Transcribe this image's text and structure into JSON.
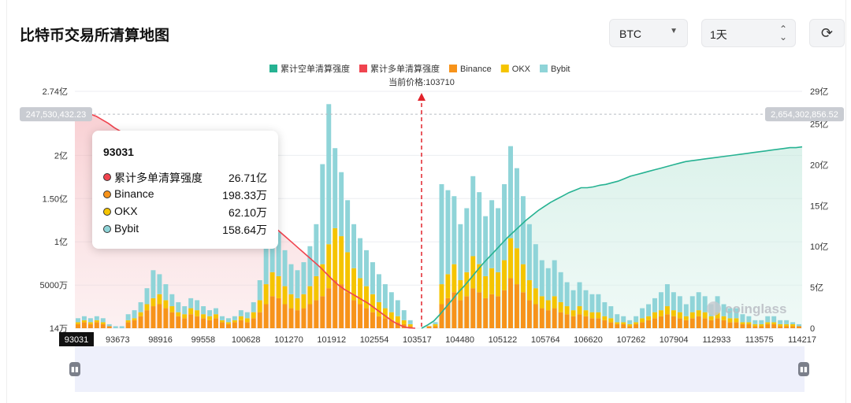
{
  "header": {
    "title": "比特币交易所清算地图",
    "asset_select": "BTC",
    "range_select": "1天",
    "refresh_icon": "refresh-icon"
  },
  "tooltip": {
    "title": "93031",
    "rows": [
      {
        "label": "累计多单清算强度",
        "value": "26.71亿",
        "color": "#f0444f"
      },
      {
        "label": "Binance",
        "value": "198.33万",
        "color": "#f7931a"
      },
      {
        "label": "OKX",
        "value": "62.10万",
        "color": "#f5c400"
      },
      {
        "label": "Bybit",
        "value": "158.64万",
        "color": "#8fd4d8"
      }
    ]
  },
  "watermark": "coinglass",
  "chart_data": {
    "type": "bar",
    "legend": [
      {
        "name": "累计空单清算强度",
        "color": "#26b292"
      },
      {
        "name": "累计多单清算强度",
        "color": "#f0444f"
      },
      {
        "name": "Binance",
        "color": "#f7931a"
      },
      {
        "name": "OKX",
        "color": "#f5c400"
      },
      {
        "name": "Bybit",
        "color": "#8fd4d8"
      }
    ],
    "legend_position": "top-center",
    "current_price_label": "当前价格:103710",
    "current_price": 103710,
    "left_axis_ticks": [
      "14万",
      "5000万",
      "1亿",
      "1.50亿",
      "2亿",
      "2.74亿"
    ],
    "left_axis_values": [
      140000,
      50000000,
      100000000,
      150000000,
      200000000,
      274000000
    ],
    "left_ylim": [
      140000,
      274000000
    ],
    "right_axis_ticks": [
      "0",
      "5亿",
      "10亿",
      "15亿",
      "20亿",
      "25亿",
      "29亿"
    ],
    "right_axis_values": [
      0,
      500000000,
      1000000000,
      1500000000,
      2000000000,
      2500000000,
      2900000000
    ],
    "right_ylim": [
      0,
      2900000000
    ],
    "left_marker_label": "247,530,432.23",
    "left_marker_value": 247530432.23,
    "right_marker_label": "2,654,302,856.52",
    "right_marker_value": 2654302856.52,
    "x_ticks": [
      "93031",
      "93673",
      "98916",
      "99558",
      "100628",
      "101270",
      "101912",
      "102554",
      "103517",
      "104480",
      "105122",
      "105764",
      "106620",
      "107262",
      "107904",
      "112933",
      "113575",
      "114217"
    ],
    "x_range": [
      93031,
      114217
    ],
    "selected_x": "93031",
    "grid": true,
    "bars": {
      "Binance": [
        2,
        3,
        2,
        3,
        2,
        1,
        0,
        0,
        3,
        4,
        6,
        9,
        11,
        12,
        10,
        8,
        6,
        5,
        7,
        6,
        5,
        4,
        5,
        3,
        2,
        3,
        4,
        3,
        5,
        8,
        12,
        16,
        15,
        12,
        10,
        9,
        10,
        12,
        14,
        16,
        20,
        24,
        22,
        18,
        14,
        12,
        10,
        8,
        6,
        5,
        4,
        3,
        2,
        1,
        0,
        0,
        1,
        1,
        12,
        15,
        18,
        14,
        16,
        20,
        18,
        15,
        17,
        16,
        19,
        25,
        22,
        18,
        14,
        12,
        10,
        9,
        10,
        8,
        7,
        6,
        7,
        6,
        5,
        5,
        4,
        3,
        2,
        2,
        1,
        2,
        3,
        4,
        5,
        6,
        7,
        6,
        5,
        4,
        5,
        6,
        5,
        4,
        5,
        4,
        3,
        3,
        2,
        2,
        1,
        1,
        2,
        2,
        1,
        1,
        1,
        1
      ],
      "OKX": [
        1,
        1,
        1,
        1,
        1,
        0,
        0,
        0,
        1,
        1,
        2,
        3,
        4,
        5,
        4,
        3,
        2,
        2,
        3,
        3,
        2,
        2,
        2,
        1,
        1,
        1,
        2,
        2,
        3,
        6,
        10,
        12,
        11,
        9,
        7,
        6,
        7,
        9,
        12,
        16,
        22,
        26,
        24,
        20,
        16,
        13,
        11,
        9,
        7,
        5,
        4,
        3,
        2,
        1,
        0,
        0,
        0,
        1,
        10,
        12,
        14,
        10,
        12,
        16,
        14,
        11,
        13,
        12,
        15,
        20,
        18,
        14,
        10,
        8,
        6,
        5,
        6,
        5,
        4,
        3,
        4,
        3,
        3,
        3,
        2,
        2,
        1,
        1,
        1,
        1,
        2,
        2,
        3,
        3,
        4,
        3,
        3,
        2,
        3,
        3,
        3,
        2,
        3,
        2,
        2,
        2,
        1,
        1,
        1,
        1,
        1,
        1,
        1,
        1,
        1,
        0
      ],
      "Bybit": [
        2,
        2,
        2,
        2,
        2,
        1,
        1,
        1,
        3,
        4,
        5,
        8,
        14,
        10,
        8,
        6,
        5,
        4,
        5,
        5,
        4,
        3,
        3,
        2,
        2,
        2,
        3,
        3,
        5,
        10,
        18,
        24,
        22,
        18,
        15,
        14,
        16,
        20,
        26,
        50,
        70,
        40,
        32,
        26,
        22,
        20,
        18,
        16,
        14,
        12,
        10,
        8,
        5,
        2,
        0,
        0,
        0,
        1,
        50,
        42,
        34,
        28,
        32,
        40,
        36,
        30,
        34,
        32,
        38,
        46,
        40,
        34,
        28,
        22,
        18,
        16,
        18,
        15,
        12,
        10,
        12,
        10,
        9,
        9,
        7,
        6,
        4,
        3,
        2,
        3,
        5,
        6,
        7,
        9,
        11,
        9,
        8,
        6,
        8,
        9,
        8,
        6,
        8,
        6,
        5,
        5,
        4,
        3,
        2,
        2,
        3,
        3,
        2,
        2,
        1,
        1
      ]
    },
    "long_cumulative": [
      247530432,
      245000000,
      241000000,
      237000000,
      232000000,
      228000000,
      224000000,
      219000000,
      215000000,
      210000000,
      204000000,
      198000000,
      193000000,
      188000000,
      184000000,
      180000000,
      176000000,
      172000000,
      167000000,
      162000000,
      158000000,
      155000000,
      152000000,
      149000000,
      146000000,
      143000000,
      140000000,
      137000000,
      133000000,
      129000000,
      124000000,
      118000000,
      112000000,
      106000000,
      100000000,
      94000000,
      88000000,
      82000000,
      76000000,
      70000000,
      63000000,
      56000000,
      50000000,
      45000000,
      41000000,
      37000000,
      33000000,
      29000000,
      24000000,
      19000000,
      14000000,
      9000000,
      5000000,
      2000000,
      500000,
      140000
    ],
    "short_cumulative": [
      0,
      40000000,
      90000000,
      170000000,
      260000000,
      350000000,
      440000000,
      520000000,
      610000000,
      700000000,
      790000000,
      870000000,
      950000000,
      1030000000,
      1110000000,
      1180000000,
      1250000000,
      1320000000,
      1380000000,
      1440000000,
      1490000000,
      1540000000,
      1580000000,
      1620000000,
      1660000000,
      1690000000,
      1720000000,
      1720000000,
      1730000000,
      1750000000,
      1760000000,
      1780000000,
      1800000000,
      1830000000,
      1860000000,
      1880000000,
      1900000000,
      1920000000,
      1940000000,
      1960000000,
      1980000000,
      2000000000,
      2020000000,
      2040000000,
      2050000000,
      2060000000,
      2070000000,
      2080000000,
      2090000000,
      2100000000,
      2110000000,
      2120000000,
      2130000000,
      2140000000,
      2150000000,
      2160000000,
      2170000000,
      2180000000,
      2190000000,
      2200000000,
      2210000000,
      2210000000,
      2220000000
    ]
  }
}
